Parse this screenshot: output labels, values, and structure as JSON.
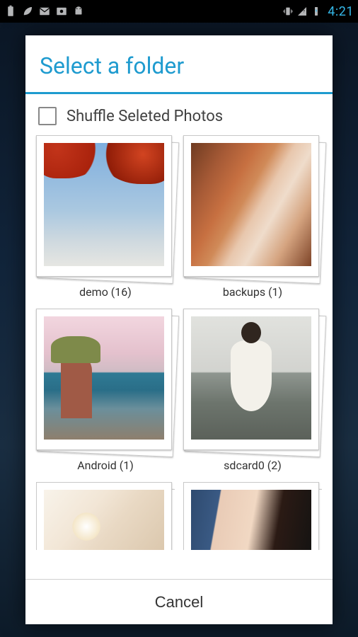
{
  "status_bar": {
    "time": "4:21"
  },
  "dialog": {
    "title": "Select a folder",
    "shuffle_label": "Shuffle Seleted Photos",
    "cancel": "Cancel"
  },
  "folders": [
    {
      "label": "demo (16)"
    },
    {
      "label": "backups (1)"
    },
    {
      "label": "Android (1)"
    },
    {
      "label": "sdcard0 (2)"
    }
  ]
}
